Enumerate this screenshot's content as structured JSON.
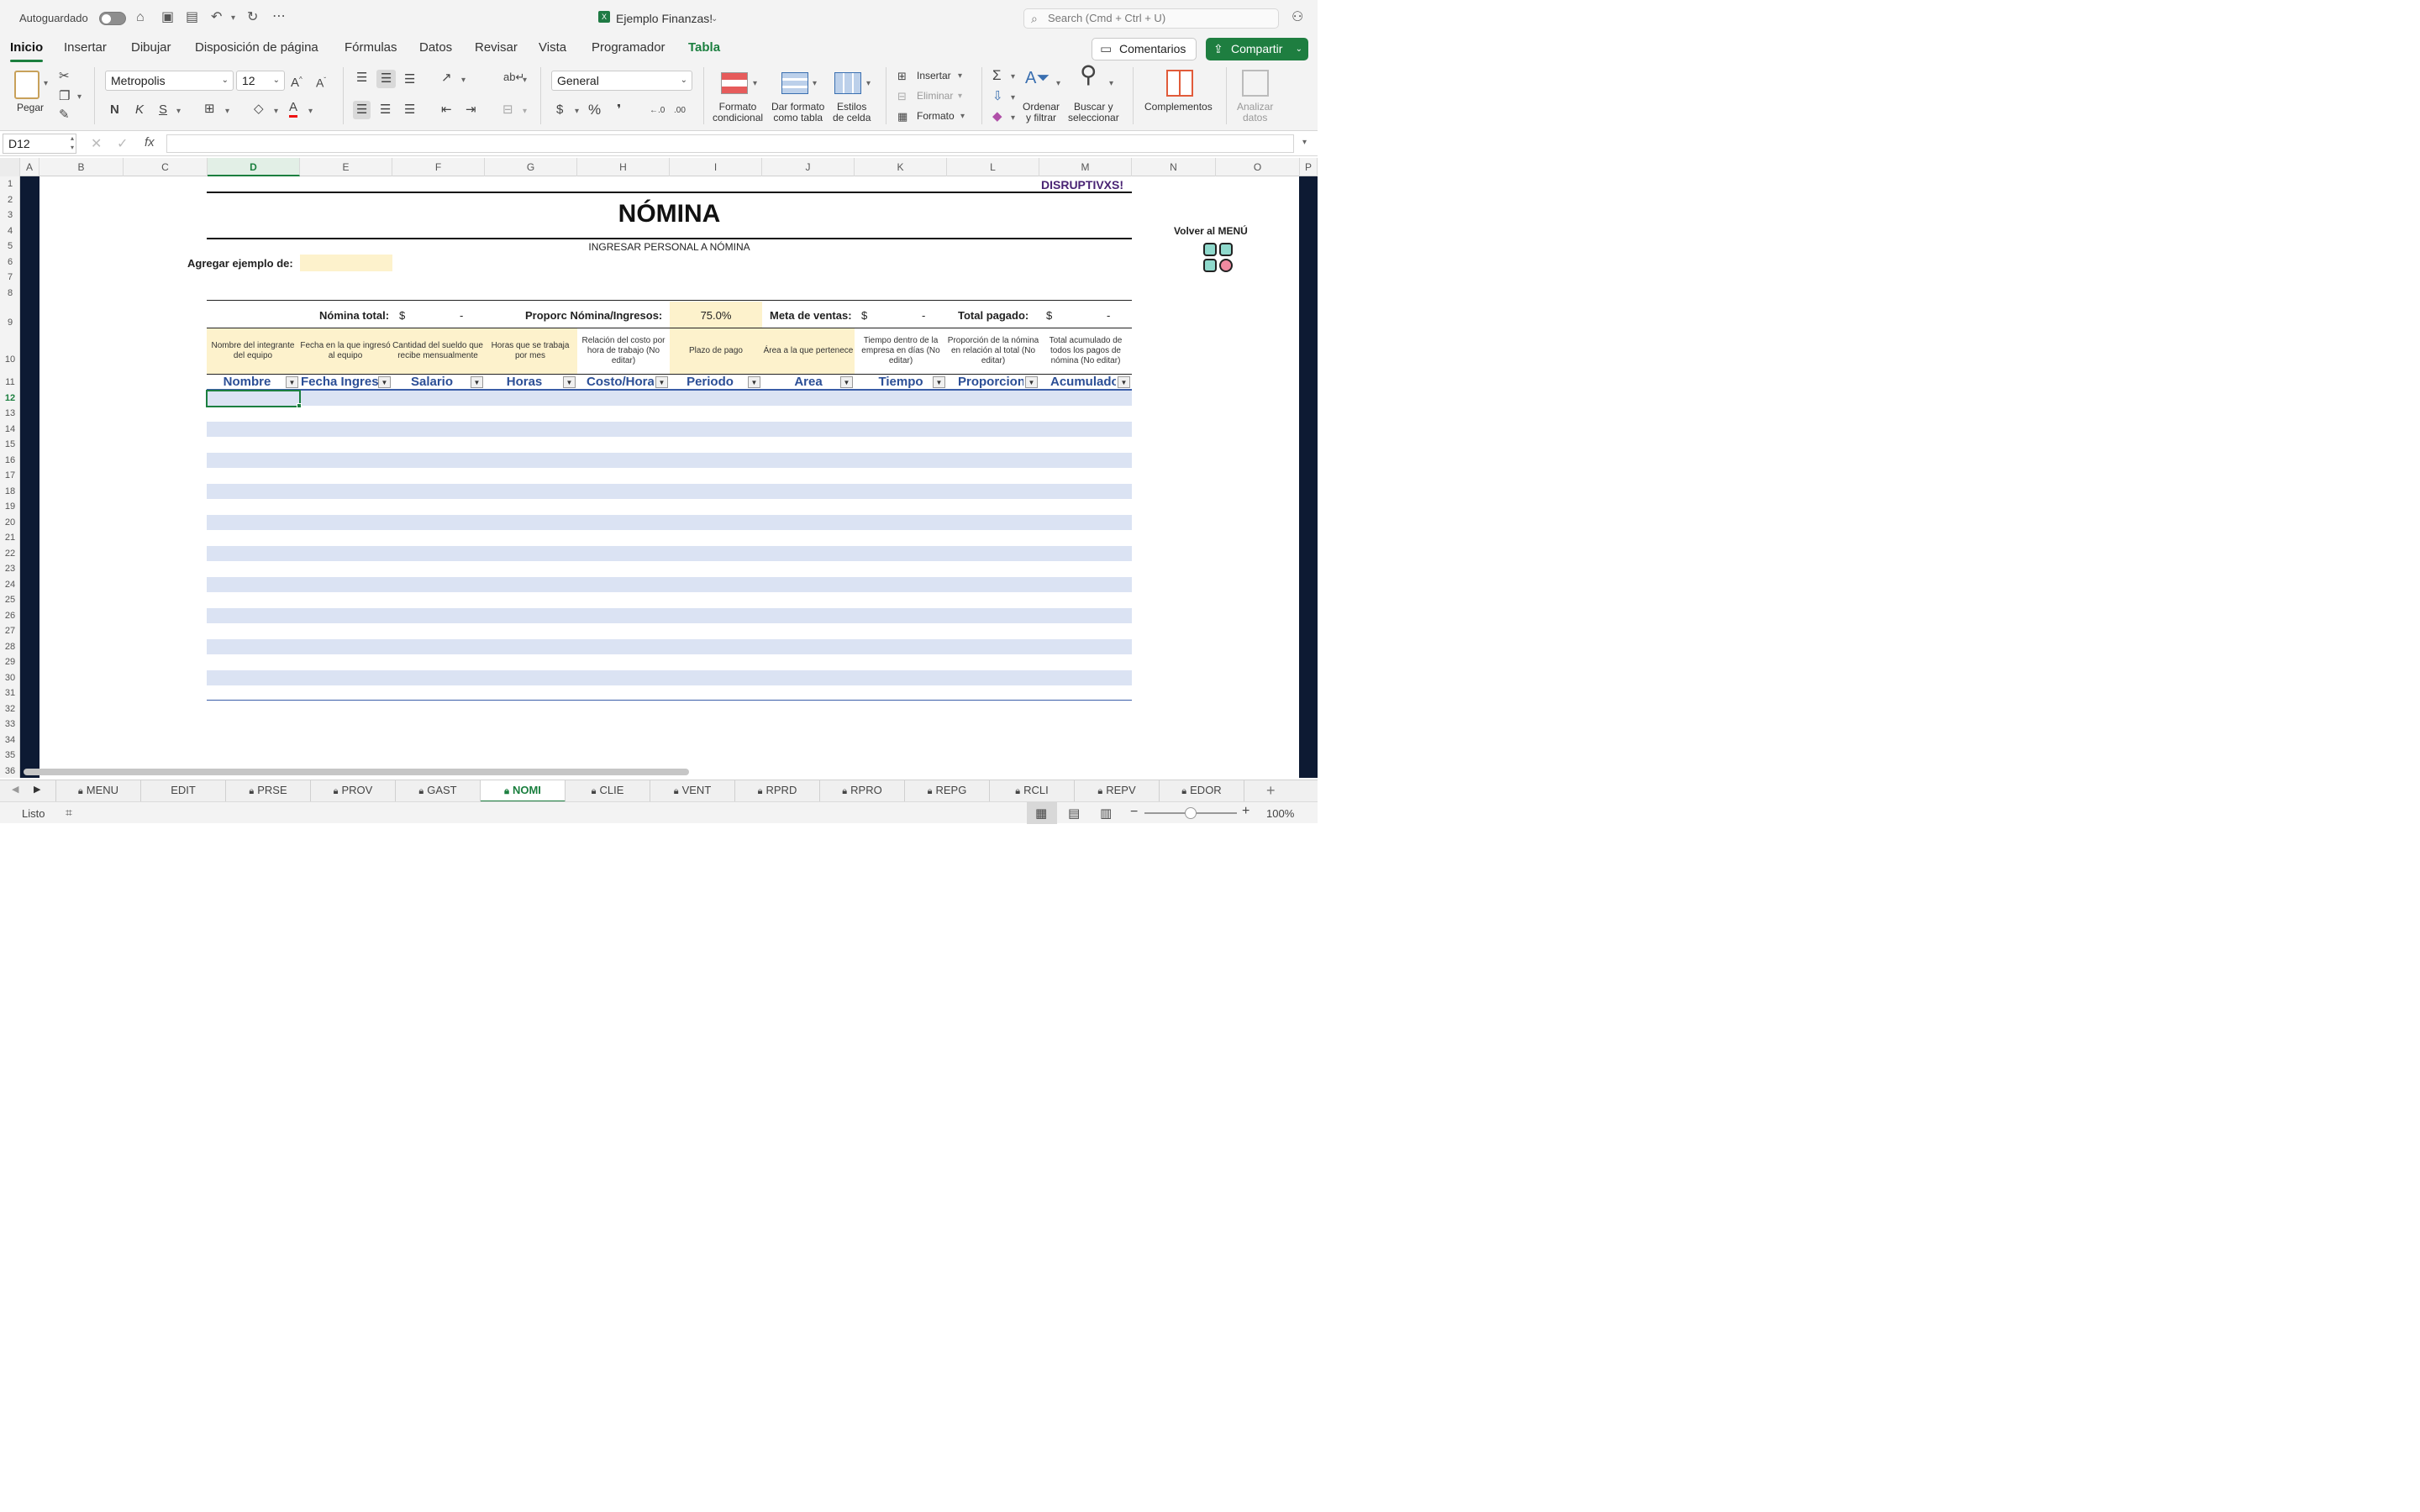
{
  "titlebar": {
    "autosave_label": "Autoguardado",
    "doc_title": "Ejemplo Finanzas!",
    "search_placeholder": "Search (Cmd + Ctrl + U)"
  },
  "menu": {
    "tabs": [
      "Inicio",
      "Insertar",
      "Dibujar",
      "Disposición de página",
      "Fórmulas",
      "Datos",
      "Revisar",
      "Vista",
      "Programador",
      "Tabla"
    ],
    "comments_label": "Comentarios",
    "share_label": "Compartir"
  },
  "ribbon": {
    "paste_label": "Pegar",
    "font_name": "Metropolis",
    "font_size": "12",
    "bold": "N",
    "italic": "K",
    "underline": "S",
    "number_format": "General",
    "currency": "$",
    "percent": "%",
    "comma": "❜",
    "cond_format": [
      "Formato",
      "condicional"
    ],
    "table_format": [
      "Dar formato",
      "como tabla"
    ],
    "cell_styles": [
      "Estilos",
      "de celda"
    ],
    "insert": "Insertar",
    "delete": "Eliminar",
    "format": "Formato",
    "sort_filter": [
      "Ordenar",
      "y filtrar"
    ],
    "find_select": [
      "Buscar y",
      "seleccionar"
    ],
    "addins": "Complementos",
    "analyze": [
      "Analizar",
      "datos"
    ]
  },
  "formula": {
    "name_box": "D12",
    "fx": "fx",
    "value": ""
  },
  "columns": [
    "A",
    "B",
    "C",
    "D",
    "E",
    "F",
    "G",
    "H",
    "I",
    "J",
    "K",
    "L",
    "M",
    "N",
    "O",
    "P"
  ],
  "rows": [
    "1",
    "2",
    "3",
    "4",
    "5",
    "6",
    "7",
    "8",
    "9",
    "10",
    "11",
    "12",
    "13",
    "14",
    "15",
    "16",
    "17",
    "18",
    "19",
    "20",
    "21",
    "22",
    "23",
    "24",
    "25",
    "26",
    "27",
    "28",
    "29",
    "30",
    "31",
    "32",
    "33",
    "34",
    "35",
    "36"
  ],
  "sheet": {
    "brand": "DISRUPTIVXS!",
    "title": "NÓMINA",
    "subtitle": "INGRESAR PERSONAL A NÓMINA",
    "add_example_label": "Agregar ejemplo de:",
    "back_menu": "Volver al MENÚ",
    "summary": {
      "total_label": "Nómina total:",
      "total_currency": "$",
      "total_value": "-",
      "ratio_label": "Proporc Nómina/Ingresos:",
      "ratio_value": "75.0%",
      "goal_label": "Meta de ventas:",
      "goal_currency": "$",
      "goal_value": "-",
      "paid_label": "Total pagado:",
      "paid_currency": "$",
      "paid_value": "-"
    },
    "descriptions": [
      "Nombre del integrante del equipo",
      "Fecha en la que ingresó al equipo",
      "Cantidad del sueldo que recibe mensualmente",
      "Horas que se trabaja por mes",
      "Relación del costo por hora de trabajo (No editar)",
      "Plazo de pago",
      "Área a la que pertenece",
      "Tiempo dentro de la empresa en días (No editar)",
      "Proporción de la nómina en relación al total (No editar)",
      "Total acumulado de todos los pagos de nómina (No editar)"
    ],
    "headers": [
      "Nombre",
      "Fecha Ingreso",
      "Salario",
      "Horas",
      "Costo/Hora",
      "Periodo",
      "Area",
      "Tiempo",
      "Proporcion",
      "Acumulado"
    ]
  },
  "sheet_tabs": [
    "MENU",
    "EDIT",
    "PRSE",
    "PROV",
    "GAST",
    "NOMI",
    "CLIE",
    "VENT",
    "RPRD",
    "RPRO",
    "REPG",
    "RCLI",
    "REPV",
    "EDOR"
  ],
  "locked_tabs": [
    "MENU",
    "PRSE",
    "PROV",
    "GAST",
    "NOMI",
    "CLIE",
    "VENT",
    "RPRD",
    "RPRO",
    "REPG",
    "RCLI",
    "REPV",
    "EDOR"
  ],
  "active_tab": "NOMI",
  "status": {
    "ready": "Listo",
    "zoom": "100%"
  },
  "colors": {
    "accent_green": "#1b7f3f",
    "header_yellow": "#fdf2cc",
    "stripe_blue": "#dbe3f3",
    "header_text_blue": "#2c4f96",
    "brand_purple": "#4a2474",
    "side_band": "#0d1a33"
  }
}
